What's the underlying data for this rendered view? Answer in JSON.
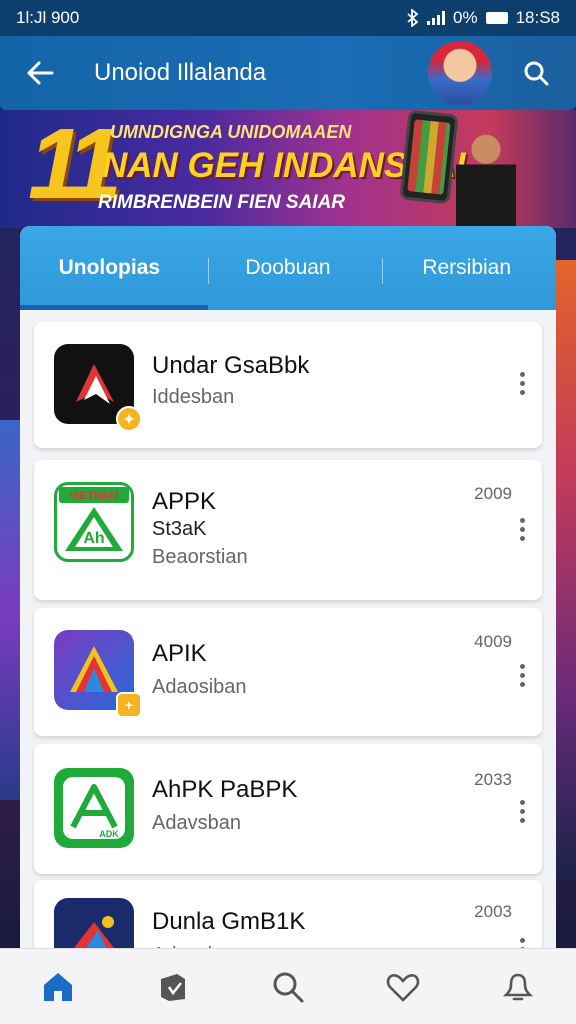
{
  "status_bar": {
    "time": "1l:Jl 900",
    "battery_percent": "0%",
    "clock": "18:S8"
  },
  "app_bar": {
    "title": "Unoiod Illalanda"
  },
  "banner": {
    "number": "11",
    "line1": "UMNDIGNGA UNIDOMAAEN",
    "line2": "NAN GEH INDANSEAI",
    "line3": "RIMBRENBEIN FIEN SAIAR"
  },
  "tabs": [
    {
      "label": "Unolopias",
      "active": true
    },
    {
      "label": "Doobuan",
      "active": false
    },
    {
      "label": "Rersibian",
      "active": false
    }
  ],
  "apps": [
    {
      "name": "Undar GsaBbk",
      "subtitle": "Iddesban",
      "line2": "",
      "year": "",
      "icon": "red-white-arrow-icon"
    },
    {
      "name": "APPK",
      "line2": "St3aK",
      "subtitle": "Beaorstian",
      "year": "2009",
      "icon": "green-a-apk-icon"
    },
    {
      "name": "APIK",
      "subtitle": "Adaosiban",
      "line2": "",
      "year": "4009",
      "icon": "colorful-a-icon"
    },
    {
      "name": "AhPK PaBPK",
      "subtitle": "Adavsban",
      "line2": "",
      "year": "2033",
      "icon": "green-apk-icon"
    },
    {
      "name": "Dunla GmB1K",
      "subtitle": "Adavsban",
      "line2": "",
      "year": "2003",
      "icon": "folder-arrow-icon"
    }
  ],
  "icon_labels": {
    "apk_text": "ADK",
    "vietnam_label": "VIETNAM"
  },
  "bottom_nav": [
    "home-icon",
    "store-icon",
    "search-icon",
    "heart-icon",
    "profile-icon"
  ],
  "colors": {
    "accent": "#2f98d9",
    "app_bar": "#1a6cb4",
    "status_bar": "#0d3f6e",
    "nav_active": "#1a6cc8"
  }
}
